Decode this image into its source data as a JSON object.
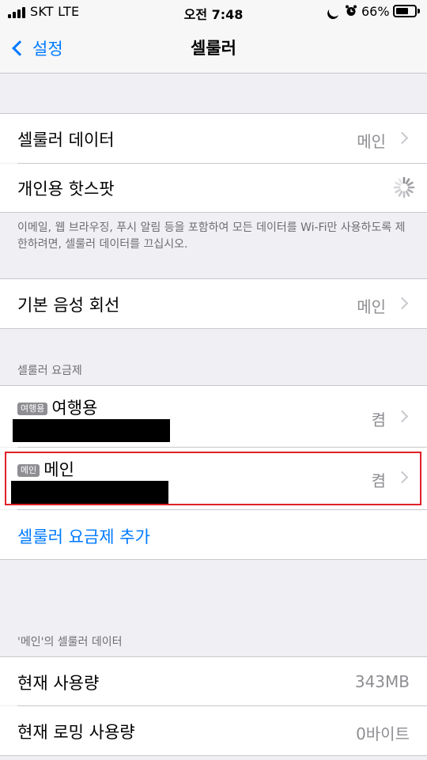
{
  "status_bar": {
    "carrier": "SKT  LTE",
    "time": "오전 7:48",
    "battery_percent": "66%",
    "battery_level": 0.66,
    "icons": [
      "signal-icon",
      "moon-icon",
      "alarm-icon",
      "battery-icon"
    ]
  },
  "nav": {
    "back_label": "설정",
    "title": "셀룰러"
  },
  "section1": {
    "cellular_data_label": "셀룰러 데이터",
    "cellular_data_value": "메인",
    "hotspot_label": "개인용 핫스팟",
    "footer": "이메일, 웹 브라우징, 푸시 알림 등을 포함하여 모든 데이터를 Wi-Fi만 사용하도록 제한하려면, 셀룰러 데이터를 끄십시오."
  },
  "section2": {
    "voice_label": "기본 음성 회선",
    "voice_value": "메인"
  },
  "plans": {
    "header": "셀룰러 요금제",
    "items": [
      {
        "badge": "여행용",
        "name": "여행용",
        "status": "켬"
      },
      {
        "badge": "메인",
        "name": "메인",
        "status": "켬"
      }
    ],
    "add_label": "셀룰러 요금제 추가"
  },
  "usage": {
    "header": "'메인'의 셀룰러 데이터",
    "current_label": "현재 사용량",
    "current_value": "343MB",
    "roaming_label": "현재 로밍 사용량",
    "roaming_value": "0바이트"
  },
  "colors": {
    "accent": "#007aff",
    "highlight": "#e0202a",
    "background": "#efeff4"
  }
}
